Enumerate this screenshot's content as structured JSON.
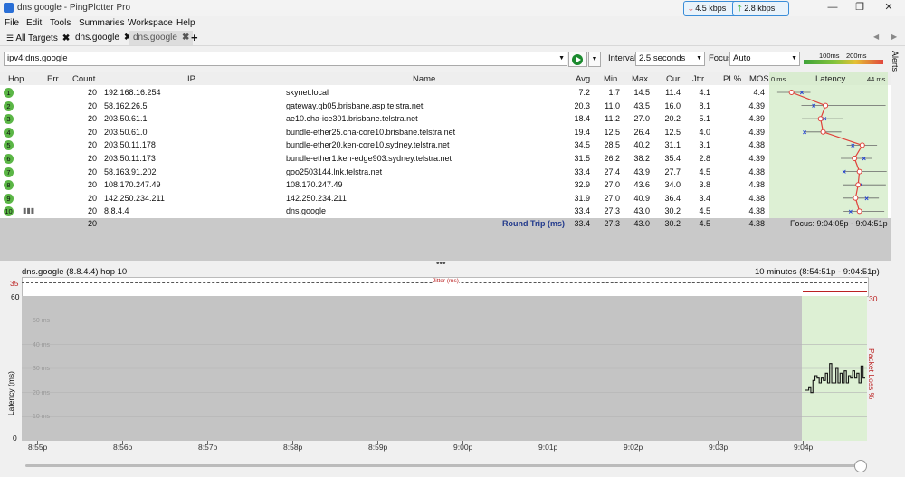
{
  "window": {
    "doc_title": "dns.google - PingPlotter Pro",
    "download_rate": "4.5 kbps",
    "upload_rate": "2.8 kbps"
  },
  "menu": [
    "File",
    "Edit",
    "Tools",
    "Summaries",
    "Workspace",
    "Help"
  ],
  "tabs": [
    {
      "label": "All Targets"
    },
    {
      "label": "dns.google"
    },
    {
      "label": "dns.google"
    }
  ],
  "toolbar": {
    "target_value": "ipv4:dns.google",
    "interval_label": "Interval",
    "interval_value": "2.5 seconds",
    "focus_label": "Focus",
    "focus_value": "Auto",
    "scale_100": "100ms",
    "scale_200": "200ms",
    "alerts_label": "Alerts"
  },
  "table": {
    "columns": {
      "hop": "Hop",
      "err": "Err",
      "count": "Count",
      "ip": "IP",
      "name": "Name",
      "avg": "Avg",
      "min": "Min",
      "max": "Max",
      "cur": "Cur",
      "jttr": "Jttr",
      "pl": "PL%",
      "mos": "MOS",
      "latency": "Latency"
    },
    "latency_min": "0 ms",
    "latency_max": "44 ms",
    "rows": [
      {
        "hop": "1",
        "count": "20",
        "ip": "192.168.16.254",
        "name": "skynet.local",
        "avg": "7.2",
        "min": "1.7",
        "max": "14.5",
        "cur": "11.4",
        "jttr": "4.1",
        "mos": "4.4"
      },
      {
        "hop": "2",
        "count": "20",
        "ip": "58.162.26.5",
        "name": "gateway.qb05.brisbane.asp.telstra.net",
        "avg": "20.3",
        "min": "11.0",
        "max": "43.5",
        "cur": "16.0",
        "jttr": "8.1",
        "mos": "4.39"
      },
      {
        "hop": "3",
        "count": "20",
        "ip": "203.50.61.1",
        "name": "ae10.cha-ice301.brisbane.telstra.net",
        "avg": "18.4",
        "min": "11.2",
        "max": "27.0",
        "cur": "20.2",
        "jttr": "5.1",
        "mos": "4.39"
      },
      {
        "hop": "4",
        "count": "20",
        "ip": "203.50.61.0",
        "name": "bundle-ether25.cha-core10.brisbane.telstra.net",
        "avg": "19.4",
        "min": "12.5",
        "max": "26.4",
        "cur": "12.5",
        "jttr": "4.0",
        "mos": "4.39"
      },
      {
        "hop": "5",
        "count": "20",
        "ip": "203.50.11.178",
        "name": "bundle-ether20.ken-core10.sydney.telstra.net",
        "avg": "34.5",
        "min": "28.5",
        "max": "40.2",
        "cur": "31.1",
        "jttr": "3.1",
        "mos": "4.38"
      },
      {
        "hop": "6",
        "count": "20",
        "ip": "203.50.11.173",
        "name": "bundle-ether1.ken-edge903.sydney.telstra.net",
        "avg": "31.5",
        "min": "26.2",
        "max": "38.2",
        "cur": "35.4",
        "jttr": "2.8",
        "mos": "4.39"
      },
      {
        "hop": "7",
        "count": "20",
        "ip": "58.163.91.202",
        "name": "goo2503144.lnk.telstra.net",
        "avg": "33.4",
        "min": "27.4",
        "max": "43.9",
        "cur": "27.7",
        "jttr": "4.5",
        "mos": "4.38"
      },
      {
        "hop": "8",
        "count": "20",
        "ip": "108.170.247.49",
        "name": "108.170.247.49",
        "avg": "32.9",
        "min": "27.0",
        "max": "43.6",
        "cur": "34.0",
        "jttr": "3.8",
        "mos": "4.38"
      },
      {
        "hop": "9",
        "count": "20",
        "ip": "142.250.234.211",
        "name": "142.250.234.211",
        "avg": "31.9",
        "min": "27.0",
        "max": "40.9",
        "cur": "36.4",
        "jttr": "3.4",
        "mos": "4.38"
      },
      {
        "hop": "10",
        "count": "20",
        "ip": "8.8.4.4",
        "name": "dns.google",
        "avg": "33.4",
        "min": "27.3",
        "max": "43.0",
        "cur": "30.2",
        "jttr": "4.5",
        "mos": "4.38"
      }
    ],
    "summary": {
      "count": "20",
      "label": "Round Trip (ms)",
      "avg": "33.4",
      "min": "27.3",
      "max": "43.0",
      "cur": "30.2",
      "jttr": "4.5",
      "mos": "4.38",
      "focus": "Focus: 9:04:05p - 9:04:51p"
    }
  },
  "graph": {
    "title": "dns.google (8.8.4.4) hop 10",
    "range": "10 minutes (8:54:51p - 9:04:51p)",
    "jitter_label": "Jitter (ms)",
    "jitter_top": "35",
    "y_label": "Latency (ms)",
    "y_right_label": "Packet Loss %",
    "y_right_value": "30",
    "y_ticks": [
      "60",
      "50 ms",
      "40 ms",
      "30 ms",
      "20 ms",
      "10 ms",
      "0"
    ],
    "x_ticks": [
      "8:55p",
      "8:56p",
      "8:57p",
      "8:58p",
      "8:59p",
      "9:00p",
      "9:01p",
      "9:02p",
      "9:03p",
      "9:04p"
    ],
    "latency_series": [
      21,
      21,
      22,
      20,
      25,
      27,
      26,
      24,
      26,
      25,
      28,
      24,
      32,
      24,
      24,
      30,
      24,
      28,
      24,
      29,
      24,
      27,
      26,
      29,
      26,
      28,
      24,
      31,
      26
    ]
  },
  "colors": {
    "hop_green": "#5bb646",
    "focus_bg": "#ddf0d4",
    "graph_bg": "#c4c4c4",
    "path_red": "#e0413a",
    "x_blue": "#1f3ed6"
  }
}
